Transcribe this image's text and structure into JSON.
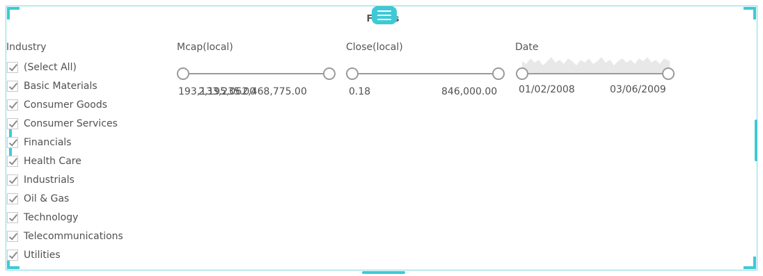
{
  "panel": {
    "title": "Filters"
  },
  "industry": {
    "label": "Industry",
    "items": [
      {
        "label": "(Select All)",
        "checked": true
      },
      {
        "label": "Basic Materials",
        "checked": true
      },
      {
        "label": "Consumer Goods",
        "checked": true
      },
      {
        "label": "Consumer Services",
        "checked": true
      },
      {
        "label": "Financials",
        "checked": true
      },
      {
        "label": "Health Care",
        "checked": true
      },
      {
        "label": "Industrials",
        "checked": true
      },
      {
        "label": "Oil & Gas",
        "checked": true
      },
      {
        "label": "Technology",
        "checked": true
      },
      {
        "label": "Telecommunications",
        "checked": true
      },
      {
        "label": "Utilities",
        "checked": true
      }
    ]
  },
  "mcap": {
    "label": "Mcap(local)",
    "min": "193,133,235.00",
    "max": "2,195,062,468,775.00"
  },
  "close": {
    "label": "Close(local)",
    "min": "0.18",
    "max": "846,000.00"
  },
  "date": {
    "label": "Date",
    "min": "01/02/2008",
    "max": "03/06/2009"
  },
  "colors": {
    "accent": "#3ec9d6",
    "border": "#7fd8e0",
    "track": "#9a9a9a"
  }
}
